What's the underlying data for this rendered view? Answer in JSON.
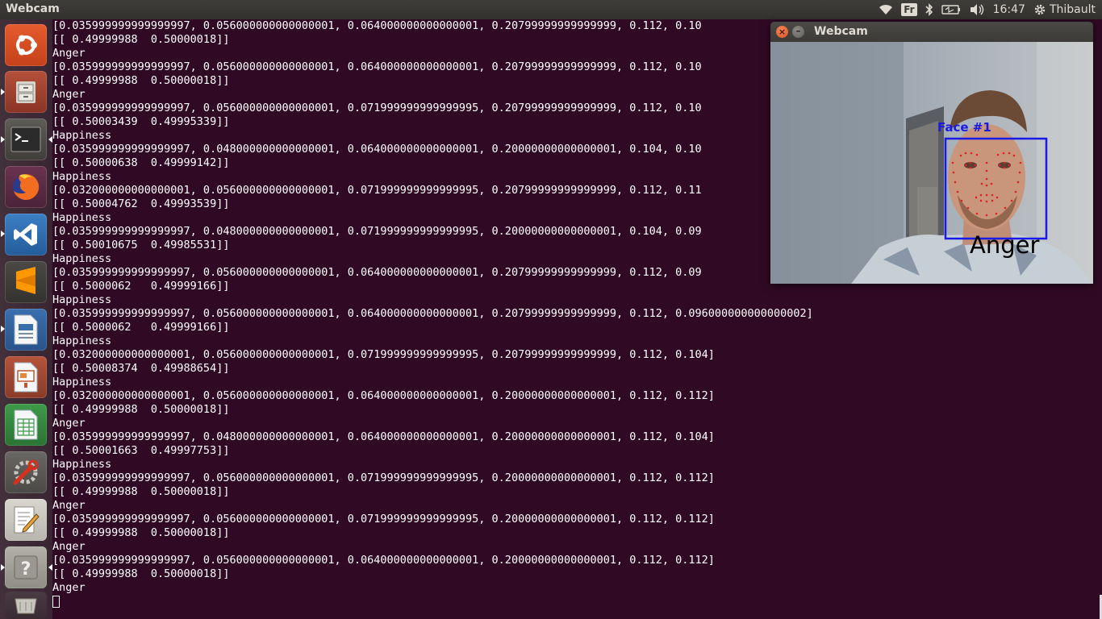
{
  "topbar": {
    "app_title": "Webcam",
    "keyboard_layout": "Fr",
    "time": "16:47",
    "user": "Thibault"
  },
  "launcher": {
    "items": [
      "Ubuntu Dash",
      "Files",
      "Terminal",
      "Firefox",
      "Visual Studio Code",
      "Sublime Text",
      "LibreOffice Writer",
      "LibreOffice Impress",
      "LibreOffice Calc",
      "System Settings",
      "Text Editor",
      "Help",
      "Trash"
    ]
  },
  "terminal": {
    "lines": [
      "[0.035999999999999997, 0.056000000000000001, 0.064000000000000001, 0.20799999999999999, 0.112, 0.10",
      "[[ 0.49999988  0.50000018]]",
      "Anger",
      "[0.035999999999999997, 0.056000000000000001, 0.064000000000000001, 0.20799999999999999, 0.112, 0.10",
      "[[ 0.49999988  0.50000018]]",
      "Anger",
      "[0.035999999999999997, 0.056000000000000001, 0.071999999999999995, 0.20799999999999999, 0.112, 0.10",
      "[[ 0.50003439  0.49995339]]",
      "Happiness",
      "[0.035999999999999997, 0.048000000000000001, 0.064000000000000001, 0.20000000000000001, 0.104, 0.10",
      "[[ 0.50000638  0.49999142]]",
      "Happiness",
      "[0.032000000000000001, 0.056000000000000001, 0.071999999999999995, 0.20799999999999999, 0.112, 0.11",
      "[[ 0.50004762  0.49993539]]",
      "Happiness",
      "[0.035999999999999997, 0.048000000000000001, 0.071999999999999995, 0.20000000000000001, 0.104, 0.09",
      "[[ 0.50010675  0.49985531]]",
      "Happiness",
      "[0.035999999999999997, 0.056000000000000001, 0.064000000000000001, 0.20799999999999999, 0.112, 0.09",
      "[[ 0.5000062   0.49999166]]",
      "Happiness",
      "[0.035999999999999997, 0.056000000000000001, 0.064000000000000001, 0.20799999999999999, 0.112, 0.096000000000000002]",
      "[[ 0.5000062   0.49999166]]",
      "Happiness",
      "[0.032000000000000001, 0.056000000000000001, 0.071999999999999995, 0.20799999999999999, 0.112, 0.104]",
      "[[ 0.50008374  0.49988654]]",
      "Happiness",
      "[0.032000000000000001, 0.056000000000000001, 0.064000000000000001, 0.20000000000000001, 0.112, 0.112]",
      "[[ 0.49999988  0.50000018]]",
      "Anger",
      "[0.035999999999999997, 0.048000000000000001, 0.064000000000000001, 0.20000000000000001, 0.112, 0.104]",
      "[[ 0.50001663  0.49997753]]",
      "Happiness",
      "[0.035999999999999997, 0.056000000000000001, 0.071999999999999995, 0.20000000000000001, 0.112, 0.112]",
      "[[ 0.49999988  0.50000018]]",
      "Anger",
      "[0.035999999999999997, 0.056000000000000001, 0.071999999999999995, 0.20000000000000001, 0.112, 0.112]",
      "[[ 0.49999988  0.50000018]]",
      "Anger",
      "[0.035999999999999997, 0.056000000000000001, 0.064000000000000001, 0.20000000000000001, 0.112, 0.112]",
      "[[ 0.49999988  0.50000018]]",
      "Anger"
    ]
  },
  "webcam_window": {
    "title": "Webcam",
    "face_label": "Face #1",
    "emotion_label": "Anger",
    "box_color": "#1a1ae6",
    "landmark_color": "#e02020"
  }
}
